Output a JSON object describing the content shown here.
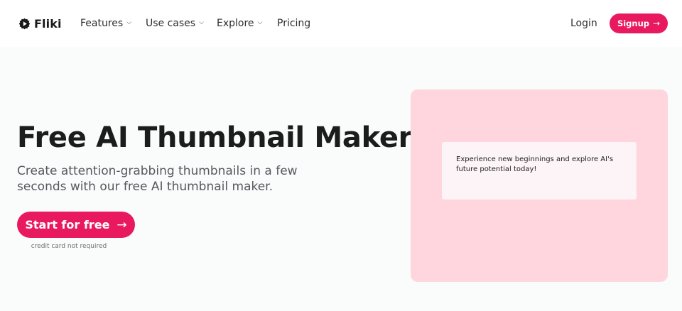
{
  "brand": {
    "name": "Fliki"
  },
  "nav": {
    "items": [
      {
        "label": "Features",
        "dropdown": true
      },
      {
        "label": "Use cases",
        "dropdown": true
      },
      {
        "label": "Explore",
        "dropdown": true
      },
      {
        "label": "Pricing",
        "dropdown": false
      }
    ],
    "dropdown_icon": "chevron-down-icon",
    "login_label": "Login",
    "signup_label": "Signup",
    "signup_icon": "arrow-right-icon"
  },
  "hero": {
    "title": "Free AI Thumbnail Maker",
    "subtitle": "Create attention-grabbing thumbnails in a few seconds with our free AI thumbnail maker.",
    "cta_label": "Start for free",
    "cta_icon": "arrow-right-icon",
    "cta_note": "credit card not required"
  },
  "preview": {
    "text": "Experience new beginnings and explore AI's future potential today!"
  },
  "colors": {
    "accent": "#e8195f",
    "page_background": "#fafbfb",
    "preview_background": "#ffd6dd",
    "preview_card": "#fcf4f6"
  }
}
